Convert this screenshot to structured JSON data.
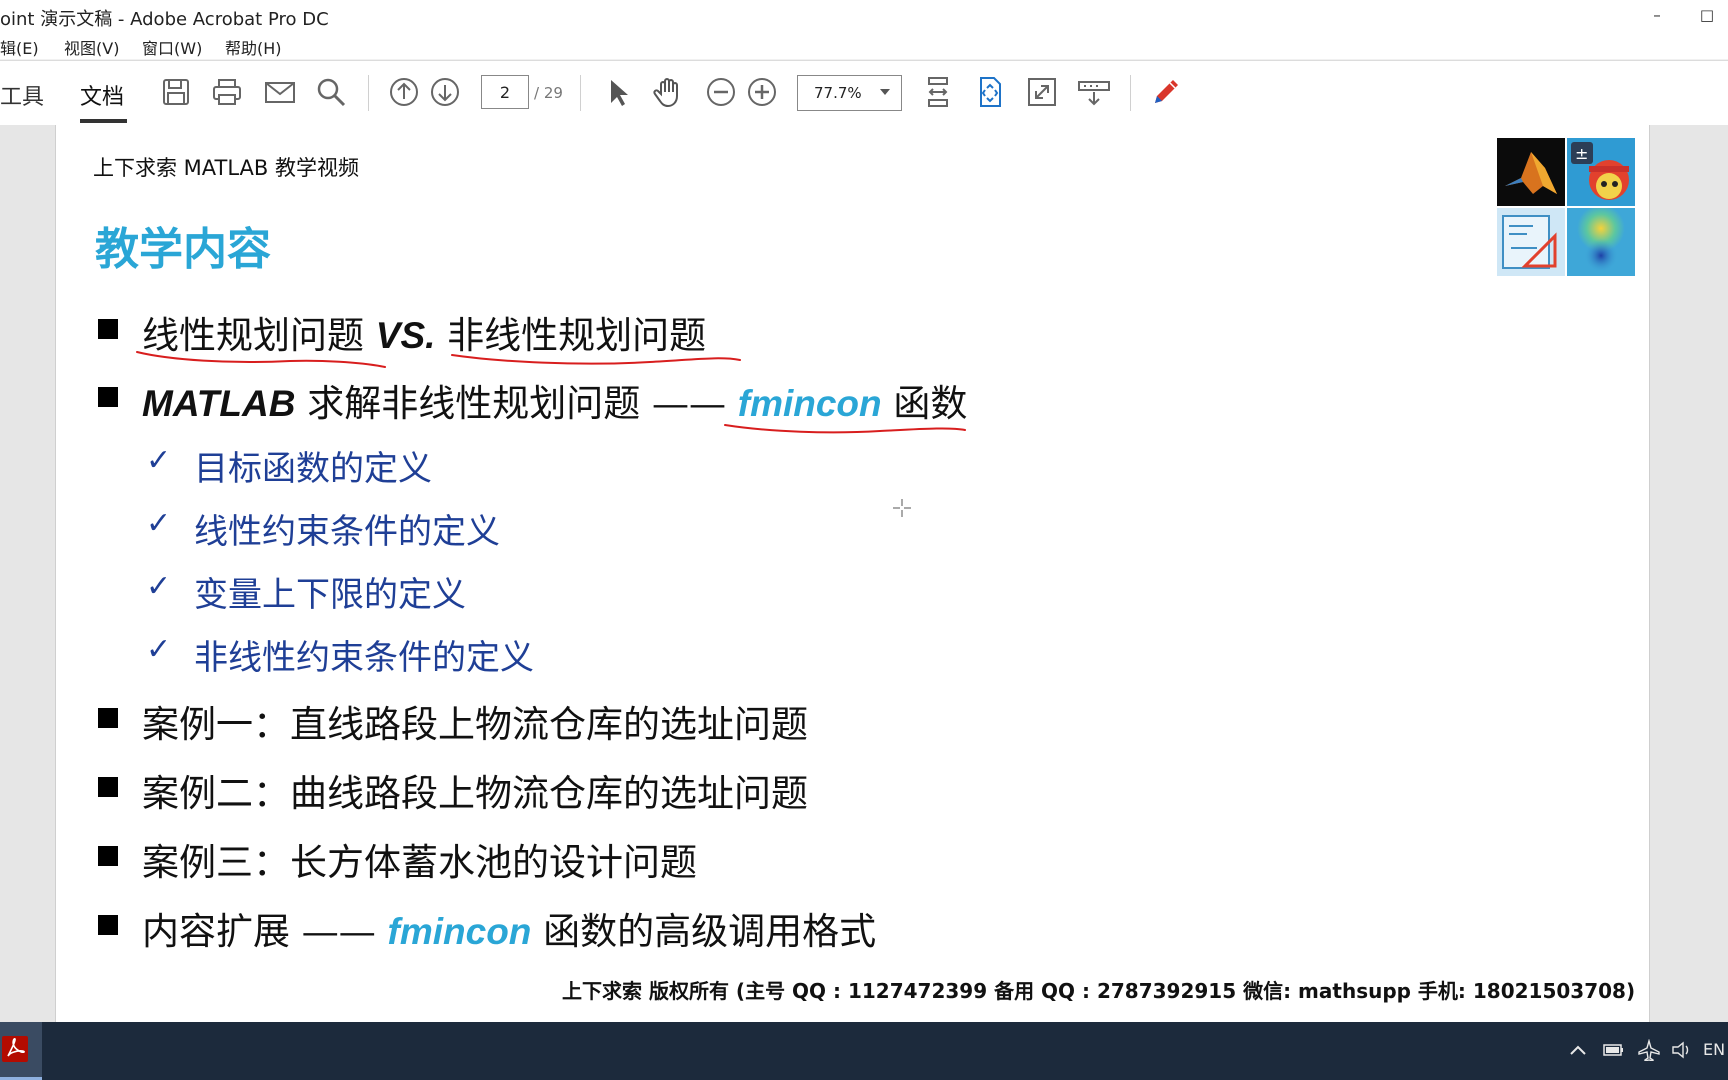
{
  "window": {
    "title": "oint 演示文稿 - Adobe Acrobat Pro DC",
    "controls": [
      "–",
      "□"
    ]
  },
  "menubar": [
    "辑(E)",
    "视图(V)",
    "窗口(W)",
    "帮助(H)"
  ],
  "toolbar": {
    "tabs": [
      "工具",
      "文档"
    ],
    "active_tab": "文档",
    "page_current": "2",
    "page_total": "/ 29",
    "zoom": "77.7%",
    "icons": [
      "save-icon",
      "print-icon",
      "email-icon",
      "search-icon",
      "page-up-icon",
      "page-down-icon",
      "select-arrow-icon",
      "hand-icon",
      "zoom-out-icon",
      "zoom-in-icon",
      "scroll-mode-icon",
      "fit-page-icon",
      "full-screen-icon",
      "read-mode-icon",
      "pen-icon"
    ]
  },
  "slide": {
    "header": "上下求索 MATLAB 教学视频",
    "title": "教学内容",
    "items": [
      {
        "pre": "线性规划问题 ",
        "em": "VS.",
        "post": " 非线性规划问题"
      },
      {
        "em": "MATLAB",
        "mid": " 求解非线性规划问题 —— ",
        "em2": "fmincon",
        "post": " 函数"
      },
      {
        "text": "案例一：直线路段上物流仓库的选址问题"
      },
      {
        "text": "案例二：曲线路段上物流仓库的选址问题"
      },
      {
        "text": "案例三：长方体蓄水池的设计问题"
      },
      {
        "pre": "内容扩展 —— ",
        "em2": "fmincon",
        "post": " 函数的高级调用格式"
      }
    ],
    "subitems": [
      "目标函数的定义",
      "线性约束条件的定义",
      "变量上下限的定义",
      "非线性约束条件的定义"
    ],
    "check_glyph": "✓",
    "footer": "上下求索  版权所有  (主号 QQ : 1127472399   备用 QQ : 2787392915   微信: mathsupp   手机: 18021503708)",
    "accent_color": "#2aa6d6",
    "sub_color": "#1f3f96",
    "annotation_color": "#d81e1e"
  },
  "taskbar": {
    "tray_lang": "EN"
  }
}
